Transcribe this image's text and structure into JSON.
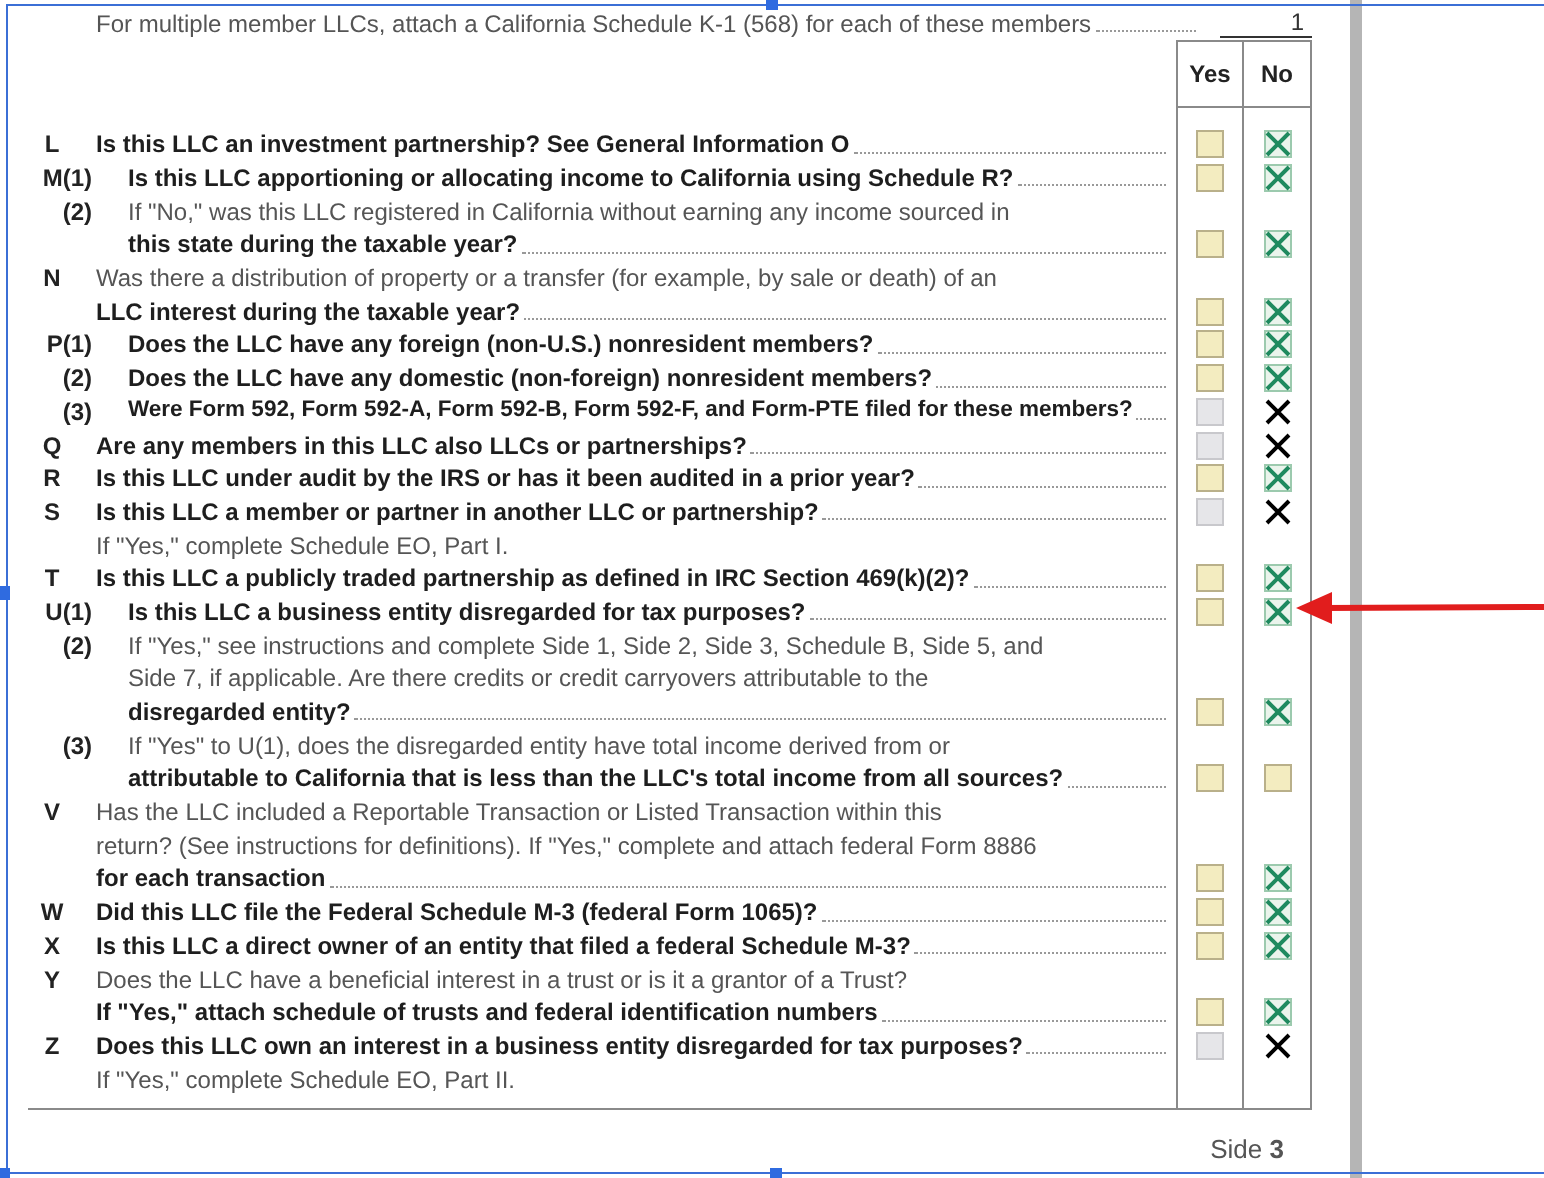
{
  "top_line": {
    "text": "For multiple member LLCs, attach a California Schedule K-1 (568) for each of these members",
    "value": "1"
  },
  "columns": [
    "Yes",
    "No"
  ],
  "questions": [
    {
      "label": "L",
      "kind": "main",
      "lines": [
        {
          "text": "Is this LLC an investment partnership? See General Information O",
          "bold": true
        }
      ],
      "yes": {
        "checked": false,
        "enabled": true
      },
      "no": {
        "checked": true,
        "enabled": true
      }
    },
    {
      "label": "M(1)",
      "kind": "sub",
      "lines": [
        {
          "text": "Is this LLC apportioning or allocating income to California using Schedule R?",
          "bold": true
        }
      ],
      "yes": {
        "checked": false,
        "enabled": true
      },
      "no": {
        "checked": true,
        "enabled": true
      }
    },
    {
      "label": "(2)",
      "kind": "sub",
      "lines": [
        {
          "text": "If \"No,\" was this LLC registered in California without earning any income sourced in",
          "bold": false
        },
        {
          "text": "this state during the taxable year?",
          "bold": true
        }
      ],
      "yes": {
        "checked": false,
        "enabled": true
      },
      "no": {
        "checked": true,
        "enabled": true
      }
    },
    {
      "label": "N",
      "kind": "main",
      "lines": [
        {
          "text": "Was there a distribution of property or a transfer (for example, by sale or death) of an",
          "bold": false
        },
        {
          "text": "LLC interest during the taxable year?",
          "bold": true
        }
      ],
      "yes": {
        "checked": false,
        "enabled": true
      },
      "no": {
        "checked": true,
        "enabled": true
      }
    },
    {
      "label": "P(1)",
      "kind": "sub",
      "lines": [
        {
          "text": "Does the LLC have any foreign (non-U.S.) nonresident members?",
          "bold": true
        }
      ],
      "yes": {
        "checked": false,
        "enabled": true
      },
      "no": {
        "checked": true,
        "enabled": true
      }
    },
    {
      "label": "(2)",
      "kind": "sub",
      "lines": [
        {
          "text": "Does the LLC have any domestic (non-foreign) nonresident members?",
          "bold": true
        }
      ],
      "yes": {
        "checked": false,
        "enabled": true
      },
      "no": {
        "checked": true,
        "enabled": true
      }
    },
    {
      "label": "(3)",
      "kind": "sub",
      "lines": [
        {
          "text": "Were Form 592, Form 592-A, Form 592-B, Form 592-F, and Form-PTE filed for these members?",
          "bold": true
        }
      ],
      "yes": {
        "checked": false,
        "enabled": false
      },
      "no": {
        "checked": true,
        "enabled": false
      }
    },
    {
      "label": "Q",
      "kind": "main",
      "lines": [
        {
          "text": "Are any members in this LLC also LLCs or partnerships?",
          "bold": true
        }
      ],
      "yes": {
        "checked": false,
        "enabled": false
      },
      "no": {
        "checked": true,
        "enabled": false
      }
    },
    {
      "label": "R",
      "kind": "main",
      "lines": [
        {
          "text": "Is this LLC under audit by the IRS or has it been audited in a prior year?",
          "bold": true
        }
      ],
      "yes": {
        "checked": false,
        "enabled": true
      },
      "no": {
        "checked": true,
        "enabled": true
      }
    },
    {
      "label": "S",
      "kind": "main",
      "lines": [
        {
          "text": "Is this LLC a member or partner in another LLC or partnership?",
          "bold": true
        }
      ],
      "note": "If \"Yes,\" complete Schedule EO, Part I.",
      "yes": {
        "checked": false,
        "enabled": false
      },
      "no": {
        "checked": true,
        "enabled": false
      }
    },
    {
      "label": "T",
      "kind": "main",
      "lines": [
        {
          "text": "Is this LLC a publicly traded partnership as defined in IRC Section 469(k)(2)?",
          "bold": true
        }
      ],
      "yes": {
        "checked": false,
        "enabled": true
      },
      "no": {
        "checked": true,
        "enabled": true
      }
    },
    {
      "label": "U(1)",
      "kind": "sub",
      "lines": [
        {
          "text": "Is this LLC a business entity disregarded for tax purposes?",
          "bold": true
        }
      ],
      "yes": {
        "checked": false,
        "enabled": true
      },
      "no": {
        "checked": true,
        "enabled": true
      }
    },
    {
      "label": "(2)",
      "kind": "sub",
      "lines": [
        {
          "text": "If \"Yes,\" see instructions and complete Side 1, Side 2, Side 3, Schedule B, Side 5, and",
          "bold": false
        },
        {
          "text": "Side 7, if applicable. Are there credits or credit carryovers attributable to the",
          "bold": false
        },
        {
          "text": "disregarded entity?",
          "bold": true
        }
      ],
      "yes": {
        "checked": false,
        "enabled": true
      },
      "no": {
        "checked": true,
        "enabled": true
      }
    },
    {
      "label": "(3)",
      "kind": "sub",
      "lines": [
        {
          "text": "If \"Yes\" to U(1), does the disregarded entity have total income derived from or",
          "bold": false
        },
        {
          "text": "attributable to California that is less than the LLC's total income from all sources?",
          "bold": true
        }
      ],
      "yes": {
        "checked": false,
        "enabled": true
      },
      "no": {
        "checked": false,
        "enabled": true
      }
    },
    {
      "label": "V",
      "kind": "main",
      "lines": [
        {
          "text": "Has the LLC included a Reportable Transaction or Listed Transaction within this",
          "bold": false
        },
        {
          "text": "return? (See instructions for definitions). If \"Yes,\" complete and attach federal Form 8886",
          "bold": false
        },
        {
          "text": "for each transaction",
          "bold": true
        }
      ],
      "yes": {
        "checked": false,
        "enabled": true
      },
      "no": {
        "checked": true,
        "enabled": true
      }
    },
    {
      "label": "W",
      "kind": "main",
      "lines": [
        {
          "text": "Did this LLC file the Federal Schedule M-3 (federal Form 1065)?",
          "bold": true
        }
      ],
      "yes": {
        "checked": false,
        "enabled": true
      },
      "no": {
        "checked": true,
        "enabled": true
      }
    },
    {
      "label": "X",
      "kind": "main",
      "lines": [
        {
          "text": "Is this LLC a direct owner of an entity that filed a federal Schedule M-3?",
          "bold": true
        }
      ],
      "yes": {
        "checked": false,
        "enabled": true
      },
      "no": {
        "checked": true,
        "enabled": true
      }
    },
    {
      "label": "Y",
      "kind": "main",
      "lines": [
        {
          "text": "Does the LLC have a beneficial interest in a trust or is it a grantor of a Trust?",
          "bold": false
        },
        {
          "text": "If \"Yes,\" attach schedule of trusts and federal identification numbers",
          "bold": true
        }
      ],
      "yes": {
        "checked": false,
        "enabled": true
      },
      "no": {
        "checked": true,
        "enabled": true
      }
    },
    {
      "label": "Z",
      "kind": "main",
      "lines": [
        {
          "text": "Does this LLC own an interest in a business entity disregarded for tax purposes?",
          "bold": true
        }
      ],
      "note": "If \"Yes,\" complete Schedule EO, Part II.",
      "yes": {
        "checked": false,
        "enabled": false
      },
      "no": {
        "checked": true,
        "enabled": false
      }
    }
  ],
  "page_footer": "Side **3**"
}
